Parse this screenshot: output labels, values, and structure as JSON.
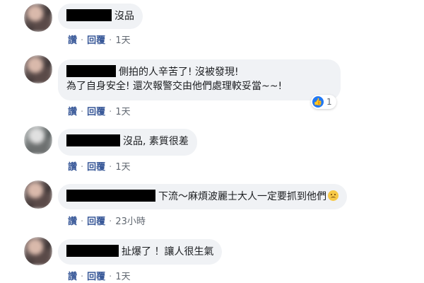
{
  "comments": [
    {
      "lines": [
        "沒品"
      ],
      "actions": {
        "reply_tag": "讚",
        "reply": "回覆",
        "time": "1天"
      }
    },
    {
      "lines": [
        "側拍的人辛苦了! 沒被發現!",
        "為了自身安全! 還次報警交由他們處理較妥當~~!"
      ],
      "reaction": {
        "icon": "like-icon",
        "count": "1"
      },
      "actions": {
        "reply_tag": "讚",
        "reply": "回覆",
        "time": "1天"
      }
    },
    {
      "lines": [
        "沒品, 素質很差"
      ],
      "actions": {
        "reply_tag": "讚",
        "reply": "回覆",
        "time": "1天"
      }
    },
    {
      "lines": [
        "下流～麻煩波麗士大人一定要抓到他們"
      ],
      "emoji": "sad-face-emoji",
      "actions": {
        "reply_tag": "讚",
        "reply": "回覆",
        "time": "23小時"
      }
    },
    {
      "lines": [
        "扯爆了 ！讓人很生氣"
      ],
      "actions": {
        "reply_tag": "讚",
        "reply": "回覆",
        "time": "1天"
      }
    }
  ],
  "colors": {
    "bubble_bg": "#f0f2f5",
    "action_link": "#385898",
    "like_blue": "#2078f4",
    "redaction": "#000000"
  }
}
